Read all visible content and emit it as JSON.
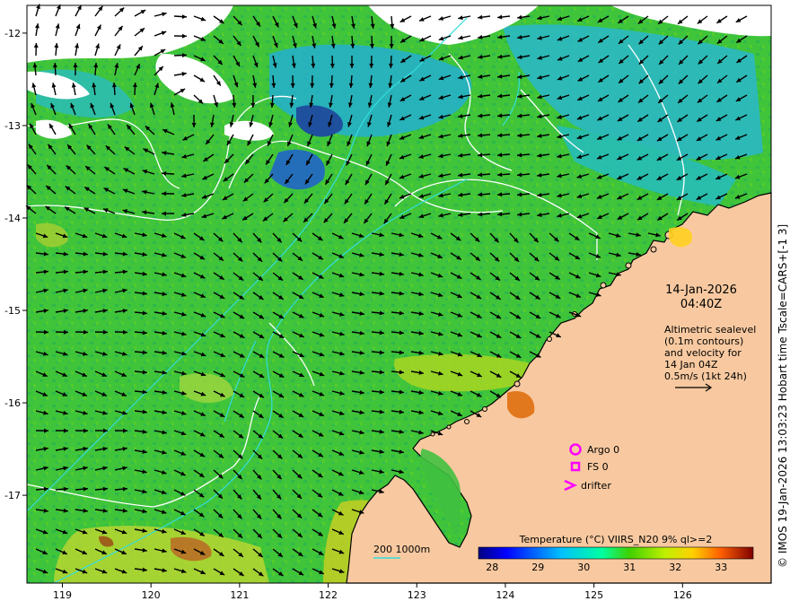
{
  "map": {
    "lon_ticks": [
      "119",
      "120",
      "121",
      "122",
      "123",
      "124",
      "125",
      "126"
    ],
    "lat_ticks": [
      "-12",
      "-13",
      "-14",
      "-15",
      "-16",
      "-17"
    ],
    "lon_range": [
      118.6,
      127.0
    ],
    "lat_range": [
      -17.95,
      -11.7
    ]
  },
  "annotation": {
    "date": "14-Jan-2026",
    "time": "04:40Z",
    "lines": [
      "Altimetric sealevel",
      "(0.1m contours)",
      "and velocity for",
      "14 Jan 04Z",
      "0.5m/s (1kt 24h)"
    ]
  },
  "legend": {
    "argo": "Argo 0",
    "fs": "FS 0",
    "drifter": "drifter",
    "bathy": "200  1000m"
  },
  "colorbar": {
    "title": "Temperature (°C) VIIRS_N20 9% ql>=2",
    "ticks": [
      "28",
      "29",
      "30",
      "31",
      "32",
      "33"
    ],
    "range": [
      27.7,
      33.7
    ],
    "colors": [
      "#00007f",
      "#0000ff",
      "#0080ff",
      "#00e0ff",
      "#00ff80",
      "#40c000",
      "#a0e000",
      "#ffe000",
      "#ff8000",
      "#e03000",
      "#7f0000"
    ]
  },
  "credit": "© IMOS 19-Jan-2026 13:03:23 Hobart time Tscale=CARS+[-1 3]",
  "colors": {
    "land": "#f8c9a0",
    "cloud": "#ffffff",
    "sst_main": "#33cc33",
    "sst_cool": "#22b2d8",
    "sst_warm": "#ddd020",
    "contour_sealevel": "#ffffff",
    "contour_bathy": "#33dddd",
    "marker": "#ff00ff"
  }
}
